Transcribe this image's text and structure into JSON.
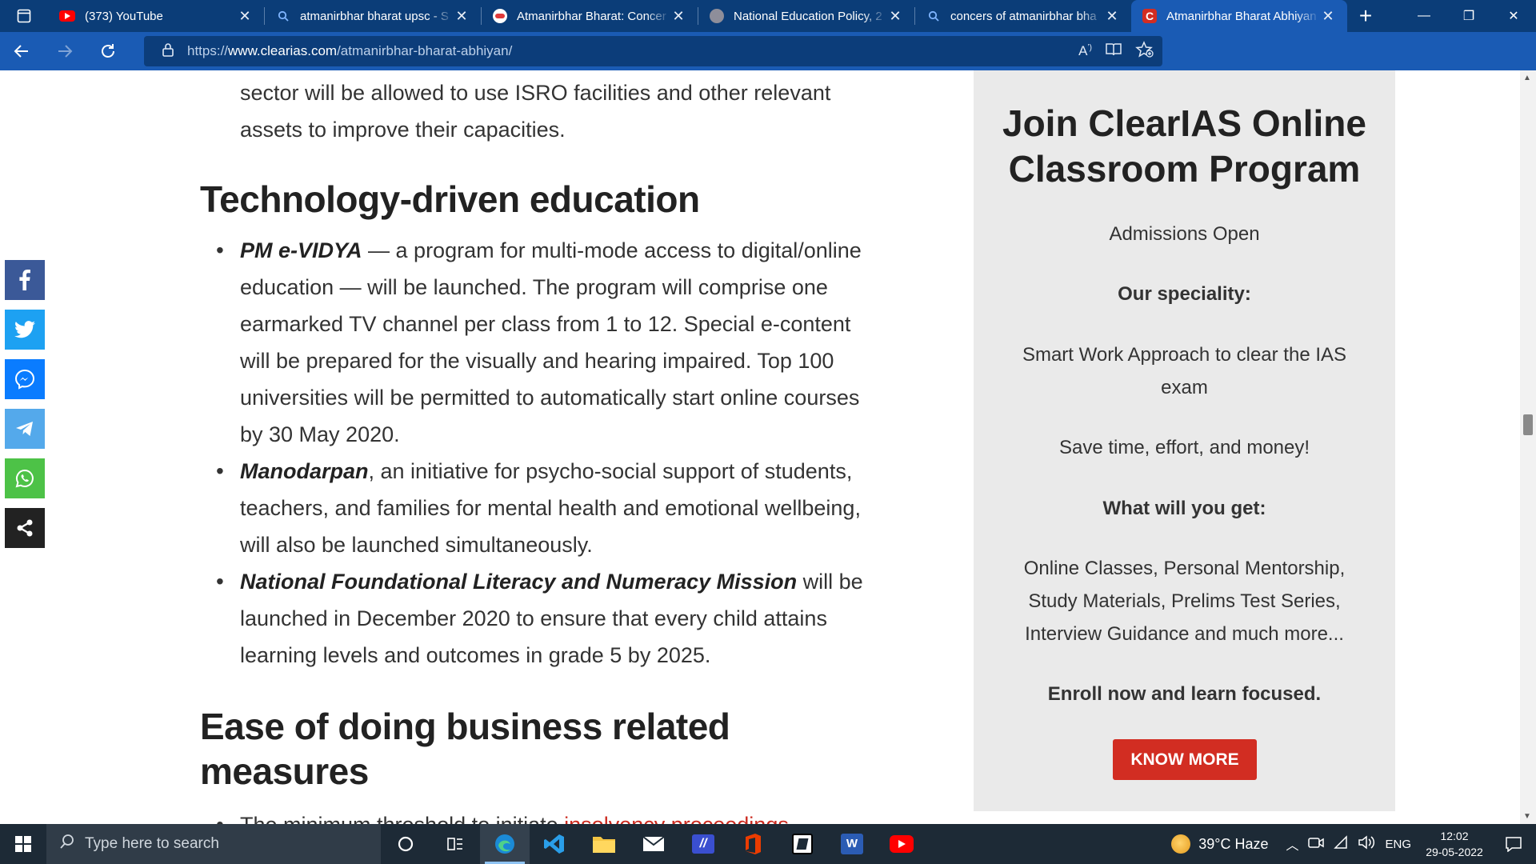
{
  "browser": {
    "tabs": [
      {
        "title": "(373) YouTube",
        "favicon": "youtube-icon",
        "active": false
      },
      {
        "title": "atmanirbhar bharat upsc - S",
        "favicon": "search-icon",
        "active": false
      },
      {
        "title": "Atmanirbhar Bharat: Concer",
        "favicon": "site-icon",
        "active": false
      },
      {
        "title": "National Education Policy, 2",
        "favicon": "site-icon",
        "active": false
      },
      {
        "title": "concers of atmanirbhar bha",
        "favicon": "search-icon",
        "active": false
      },
      {
        "title": "Atmanirbhar Bharat Abhiyan",
        "favicon": "clearias-icon",
        "active": true
      }
    ],
    "url_prefix": "https://",
    "url_domain": "www.clearias.com",
    "url_path": "/atmanirbhar-bharat-abhiyan/"
  },
  "article": {
    "isro_paragraph": "sector will be allowed to use ISRO facilities and other relevant assets to improve their capacities.",
    "heading_tech": "Technology-driven education",
    "tech_items": [
      {
        "emphasis": "PM e-VIDYA",
        "text": " — a program for multi-mode access to digital/online education — will be launched. The program will comprise one earmarked TV channel per class from 1 to 12. Special e-content will be prepared for the visually and hearing impaired. Top 100 universities will be permitted to automatically start online courses by 30 May 2020."
      },
      {
        "emphasis": "Manodarpan",
        "text": ", an initiative for psycho-social support of students, teachers, and families for mental health and emotional wellbeing, will also be launched simultaneously."
      },
      {
        "emphasis": "National Foundational Literacy and Numeracy Mission",
        "text": " will be launched in December 2020 to ensure that every child attains learning levels and outcomes in grade 5 by 2025."
      }
    ],
    "heading_ease": "Ease of doing business related measures",
    "ease_item_text": "The minimum threshold to initiate ",
    "ease_item_link": "insolvency proceedings"
  },
  "sidebar": {
    "title": "Join ClearIAS Online Classroom Program",
    "admissions": "Admissions Open",
    "speciality_label": "Our speciality:",
    "speciality_text": "Smart Work Approach to clear the IAS exam",
    "save_text": "Save time, effort, and money!",
    "get_label": "What will you get:",
    "get_text": "Online Classes, Personal Mentorship, Study Materials, Prelims Test Series, Interview Guidance and much more...",
    "enroll_text": "Enroll now and learn focused.",
    "button_label": "KNOW MORE"
  },
  "social": [
    "facebook-icon",
    "twitter-icon",
    "messenger-icon",
    "telegram-icon",
    "whatsapp-icon",
    "share-icon"
  ],
  "taskbar": {
    "search_placeholder": "Type here to search",
    "weather": "39°C  Haze",
    "language": "ENG",
    "time": "12:02",
    "date": "29-05-2022"
  },
  "colors": {
    "tabbar": "#0b3d78",
    "toolbar": "#1a5bb4",
    "accent_red": "#d22d22",
    "sidebar_bg": "#eaeaea"
  }
}
